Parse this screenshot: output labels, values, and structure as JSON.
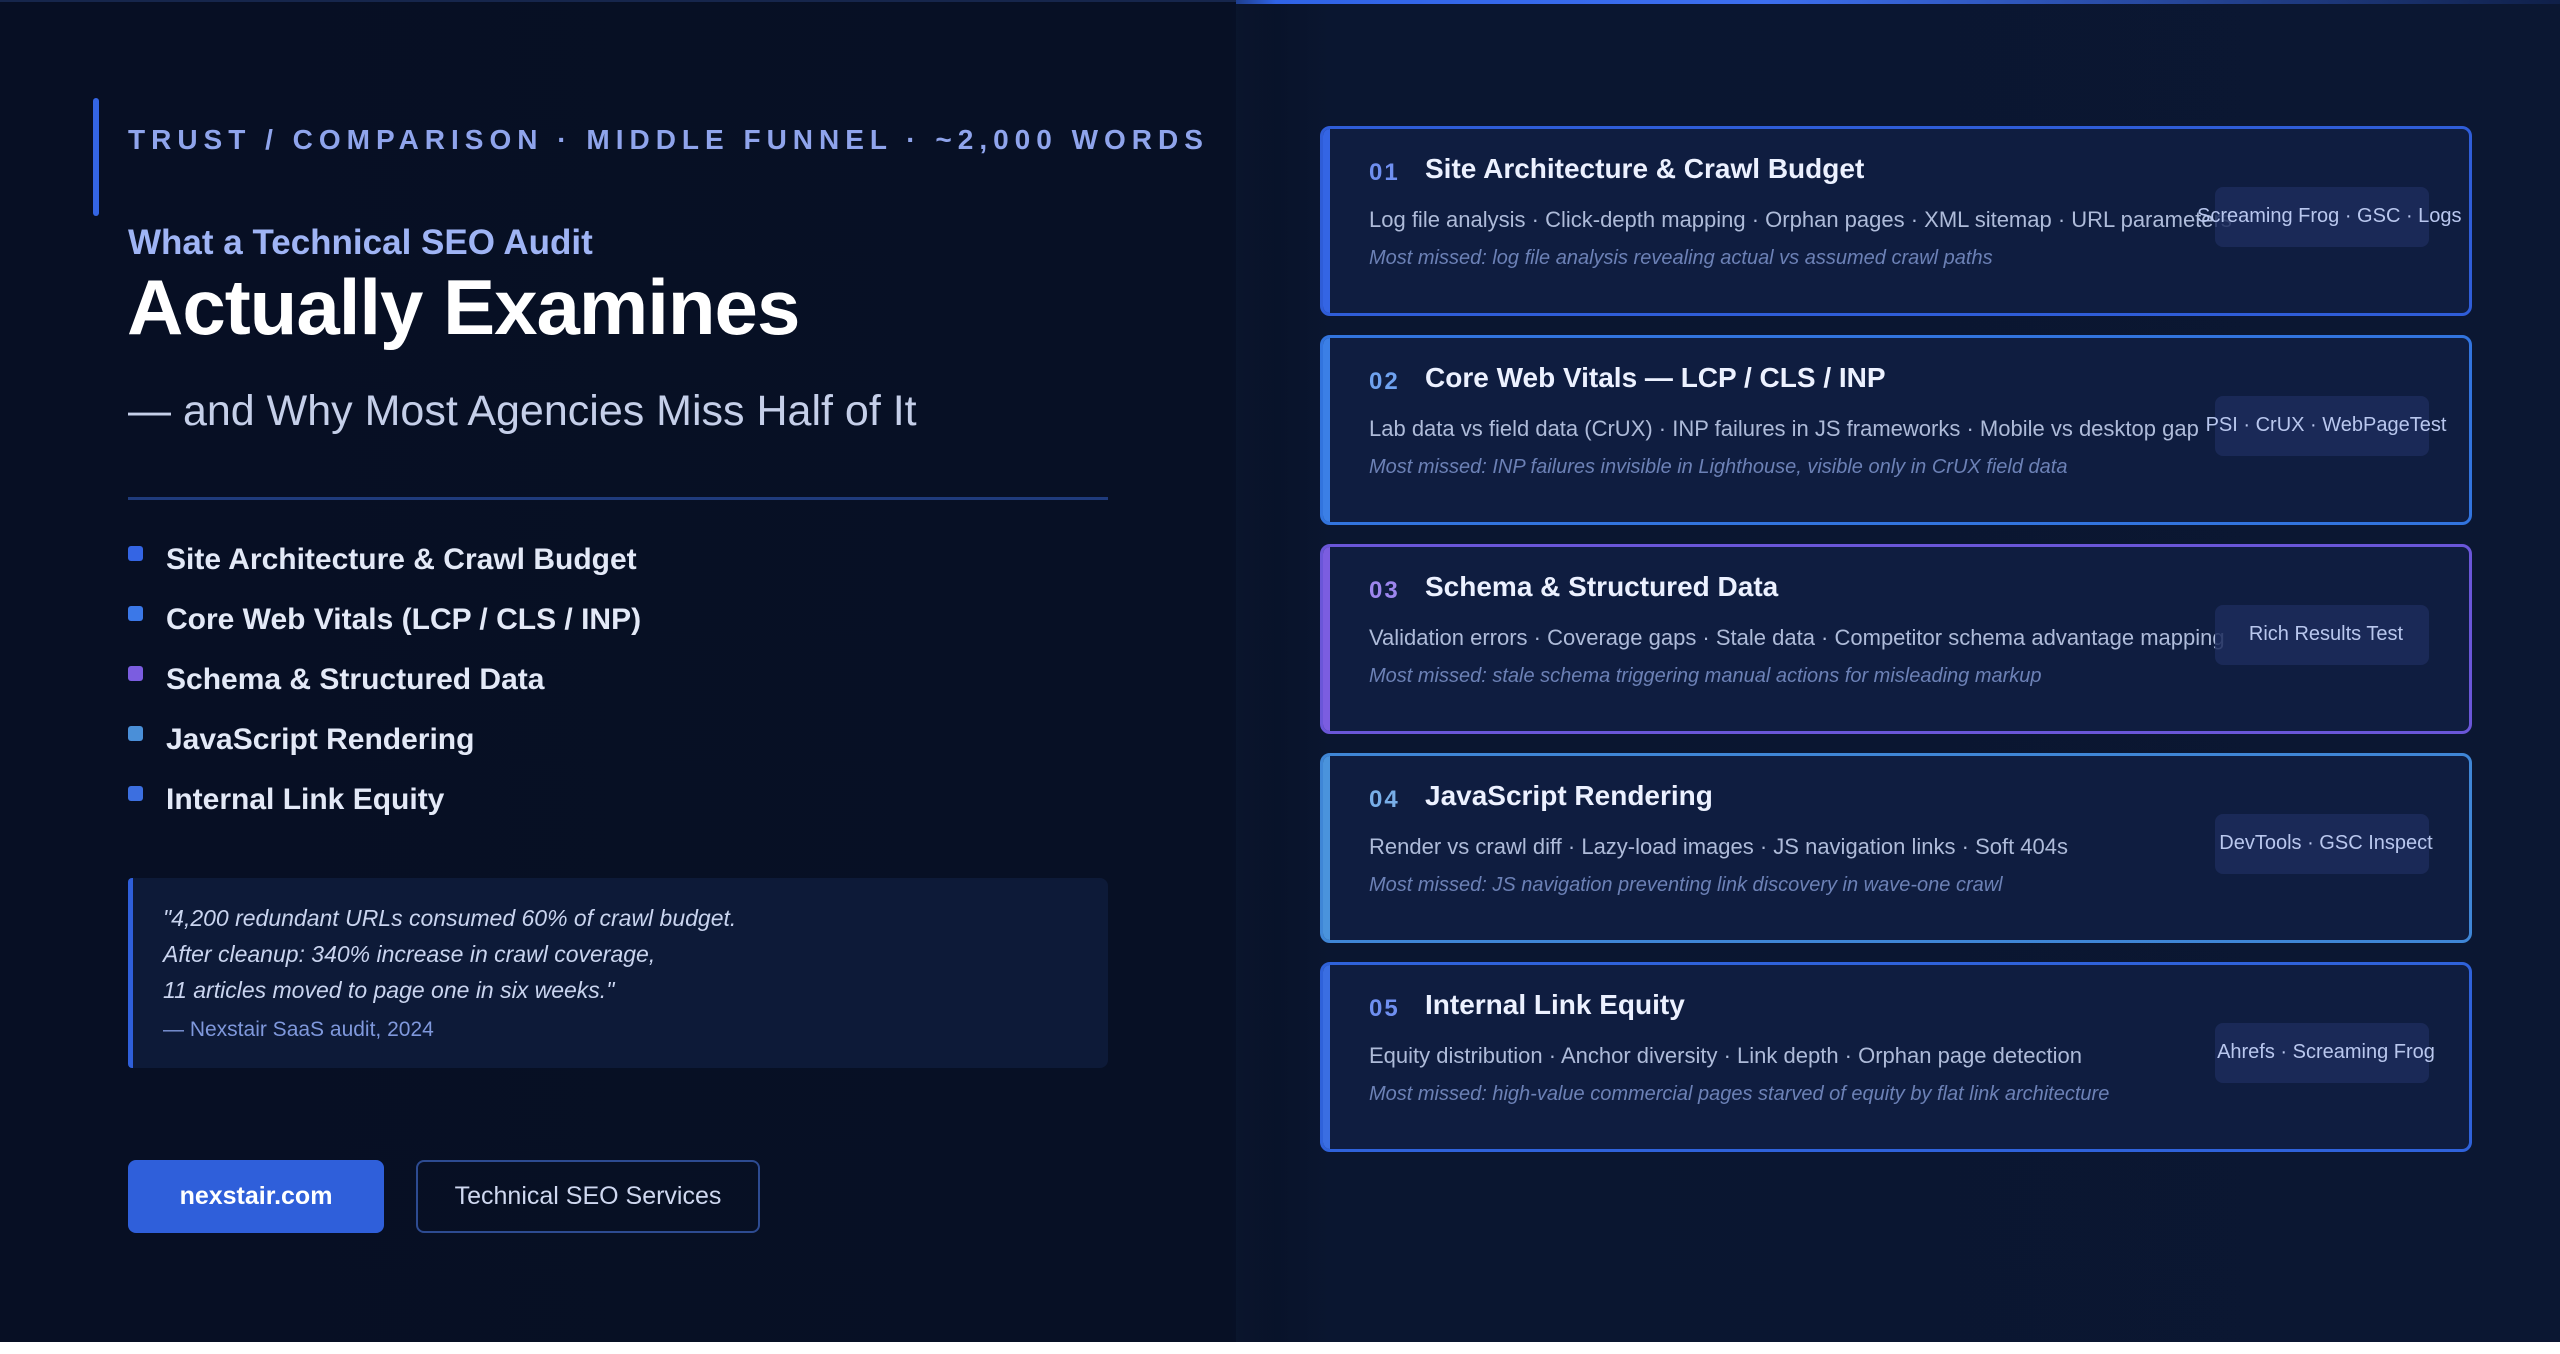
{
  "eyebrow": "TRUST / COMPARISON · MIDDLE FUNNEL · ~2,000 WORDS",
  "title_small": "What a Technical SEO Audit",
  "title_big": "Actually Examines",
  "subtitle": "— and Why Most Agencies Miss Half of It",
  "topics": [
    {
      "label": "Site Architecture & Crawl Budget",
      "color": "#3465e4"
    },
    {
      "label": "Core Web Vitals (LCP / CLS / INP)",
      "color": "#3b78e8"
    },
    {
      "label": "Schema & Structured Data",
      "color": "#7b5de0"
    },
    {
      "label": "JavaScript Rendering",
      "color": "#4a8fd8"
    },
    {
      "label": "Internal Link Equity",
      "color": "#3c6fe0"
    }
  ],
  "quote": {
    "line1": "\"4,200 redundant URLs consumed 60% of crawl budget.",
    "line2": "After cleanup: 340% increase in crawl coverage,",
    "line3": "11 articles moved to page one in six weeks.\"",
    "attribution": "— Nexstair SaaS audit, 2024"
  },
  "buttons": {
    "primary": "nexstair.com",
    "secondary": "Technical SEO Services"
  },
  "cards": [
    {
      "num": "01",
      "title": "Site Architecture & Crawl Budget",
      "desc": "Log file analysis · Click-depth mapping · Orphan pages · XML sitemap · URL parameters",
      "missed": "Most missed: log file analysis revealing actual vs assumed crawl paths",
      "tools": "Screaming Frog · GSC · Logs",
      "accent": "#3465e4",
      "border": "#2f5dd8",
      "num_color": "#6f8ff0"
    },
    {
      "num": "02",
      "title": "Core Web Vitals — LCP / CLS / INP",
      "desc": "Lab data vs field data (CrUX) · INP failures in JS frameworks · Mobile vs desktop gap",
      "missed": "Most missed: INP failures invisible in Lighthouse, visible only in CrUX field data",
      "tools": "PSI · CrUX · WebPageTest",
      "accent": "#3b7fe6",
      "border": "#3274de",
      "num_color": "#6fa2f0"
    },
    {
      "num": "03",
      "title": "Schema & Structured Data",
      "desc": "Validation errors · Coverage gaps · Stale data · Competitor schema advantage mapping",
      "missed": "Most missed: stale schema triggering manual actions for misleading markup",
      "tools": "Rich Results Test",
      "accent": "#7b5de0",
      "border": "#6a56d8",
      "num_color": "#9d86ee"
    },
    {
      "num": "04",
      "title": "JavaScript Rendering",
      "desc": "Render vs crawl diff · Lazy-load images · JS navigation links · Soft 404s",
      "missed": "Most missed: JS navigation preventing link discovery in wave-one crawl",
      "tools": "DevTools · GSC Inspect",
      "accent": "#4a93dc",
      "border": "#3f86d6",
      "num_color": "#78aee8"
    },
    {
      "num": "05",
      "title": "Internal Link Equity",
      "desc": "Equity distribution · Anchor diversity · Link depth · Orphan page detection",
      "missed": "Most missed: high-value commercial pages starved of equity by flat link architecture",
      "tools": "Ahrefs · Screaming Frog",
      "accent": "#3a6ee2",
      "border": "#2f62da",
      "num_color": "#6f8ff0"
    }
  ]
}
